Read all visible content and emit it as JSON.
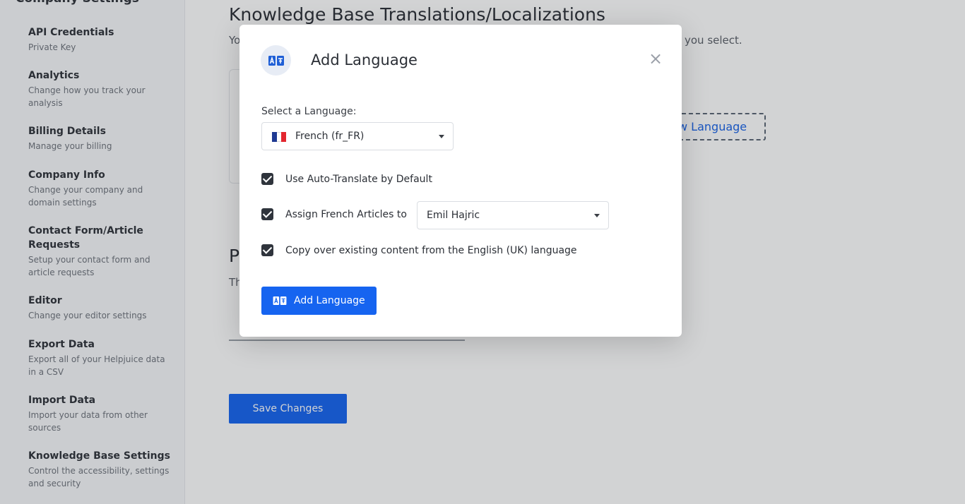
{
  "sidebar": {
    "heading": "Company Settings",
    "items": [
      {
        "title": "API Credentials",
        "desc": "Private Key"
      },
      {
        "title": "Analytics",
        "desc": "Change how you track your analysis"
      },
      {
        "title": "Billing Details",
        "desc": "Manage your billing"
      },
      {
        "title": "Company Info",
        "desc": "Change your company and domain settings"
      },
      {
        "title": "Contact Form/Article Requests",
        "desc": "Setup your contact form and article requests"
      },
      {
        "title": "Editor",
        "desc": "Change your editor settings"
      },
      {
        "title": "Export Data",
        "desc": "Export all of your Helpjuice data in a CSV"
      },
      {
        "title": "Import Data",
        "desc": "Import your data from other sources"
      },
      {
        "title": "Knowledge Base Settings",
        "desc": "Control the accessibility, settings and security"
      }
    ]
  },
  "main": {
    "title": "Knowledge Base Translations/Localizations",
    "desc_start": "Yo",
    "desc_end": "you select.",
    "new_language_fragment": "w Language",
    "section_title_fragment": "P",
    "section_desc_fragment": "Th",
    "save_label": "Save Changes"
  },
  "modal": {
    "title": "Add Language",
    "select_label": "Select a Language:",
    "selected_language": "French (fr_FR)",
    "flag_colors": [
      "#1f3a93",
      "#ffffff",
      "#e3262f"
    ],
    "auto_translate_label": "Use Auto-Translate by Default",
    "assign_label": "Assign French Articles to",
    "assignee": "Emil Hajric",
    "copy_label": "Copy over existing content from the English (UK) language",
    "add_button_label": "Add Language",
    "close_symbol": "×",
    "cursor_symbol": "I"
  },
  "colors": {
    "accent": "#1664f0",
    "checkbox": "#2f343c"
  }
}
